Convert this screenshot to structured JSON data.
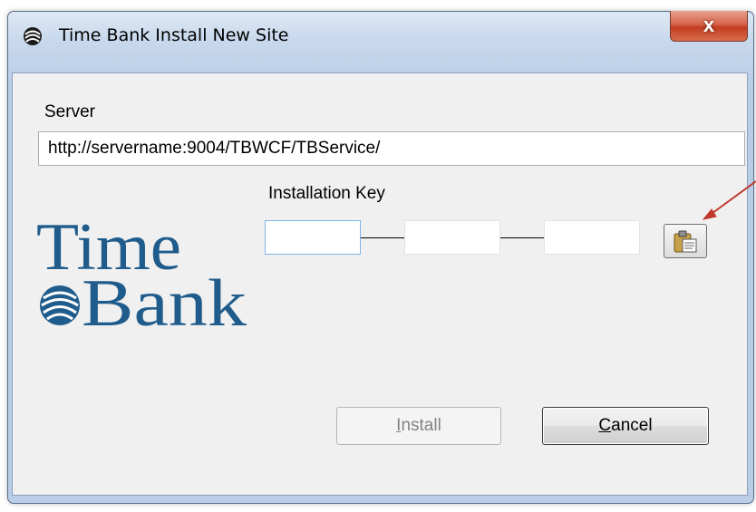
{
  "window": {
    "title": "Time Bank Install New Site",
    "close_glyph": "x"
  },
  "server": {
    "label": "Server",
    "value": "http://servername:9004/TBWCF/TBService/"
  },
  "installation_key": {
    "label": "Installation Key",
    "fields": [
      "",
      "",
      ""
    ],
    "paste_icon": "paste-clipboard-icon"
  },
  "logo": {
    "line1": "Time",
    "line2": "Bank",
    "color": "#1f5c8c"
  },
  "buttons": {
    "install": {
      "prefix": "",
      "accel": "I",
      "rest": "nstall",
      "enabled": false
    },
    "cancel": {
      "prefix": "",
      "accel": "C",
      "rest": "ancel",
      "enabled": true
    }
  },
  "annotation": {
    "arrow_color": "#c0392b"
  },
  "colors": {
    "titlebar": "#c9d9ed",
    "client_bg": "#f0f0f0",
    "close_button": "#c23d22"
  }
}
